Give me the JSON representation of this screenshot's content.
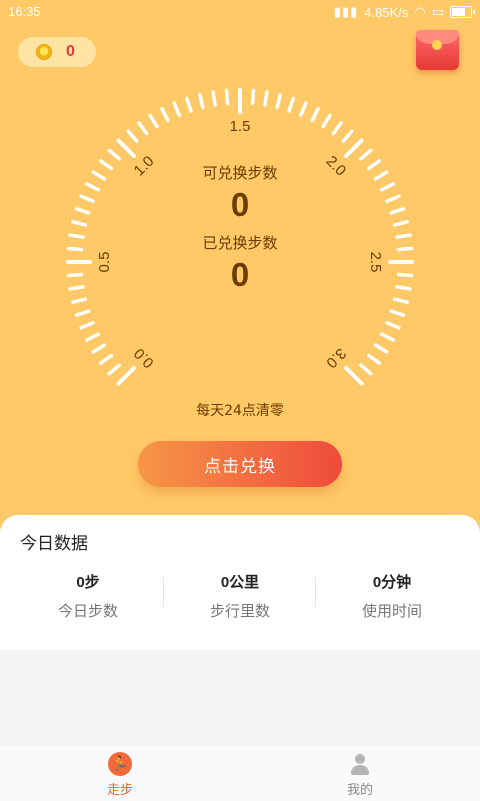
{
  "status_bar": {
    "time": "16:35",
    "network_speed": "4.85K/s",
    "icons": [
      "signal-icon",
      "wifi-icon",
      "sim-icon",
      "battery-icon"
    ]
  },
  "header": {
    "coin_count": "0",
    "coin_icon": "coin-icon",
    "red_packet_icon": "red-packet-icon"
  },
  "gauge": {
    "tick_labels": [
      "0.0",
      "0.5",
      "1.0",
      "1.5",
      "2.0",
      "2.5",
      "3.0"
    ],
    "exchangeable_label": "可兑换步数",
    "exchangeable_value": "0",
    "exchanged_label": "已兑换步数",
    "exchanged_value": "0",
    "reset_note": "每天24点清零"
  },
  "exchange_button": "点击兑换",
  "today": {
    "title": "今日数据",
    "stats": [
      {
        "value": "0步",
        "label": "今日步数"
      },
      {
        "value": "0公里",
        "label": "步行里数"
      },
      {
        "value": "0分钟",
        "label": "使用时间"
      }
    ]
  },
  "tabs": [
    {
      "label": "走步",
      "icon": "walk-icon",
      "active": true
    },
    {
      "label": "我的",
      "icon": "user-icon",
      "active": false
    }
  ],
  "colors": {
    "background_top": "#fec966",
    "text_brown": "#6b3b00",
    "button_start": "#f79646",
    "button_end": "#ee4b3c",
    "accent": "#e8632d"
  }
}
